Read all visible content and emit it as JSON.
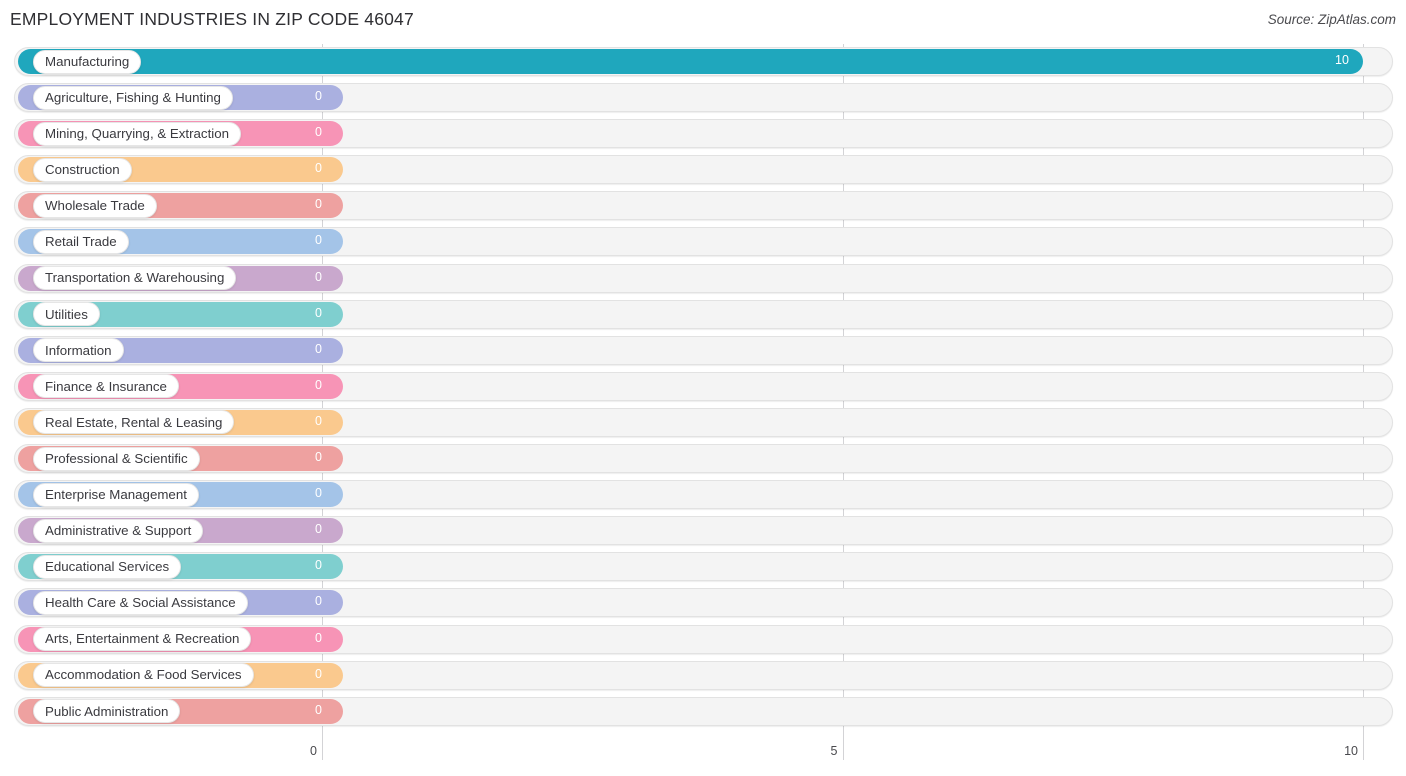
{
  "header": {
    "title": "EMPLOYMENT INDUSTRIES IN ZIP CODE 46047",
    "source": "Source: ZipAtlas.com"
  },
  "axis": {
    "ticks": [
      {
        "label": "0",
        "value": 0
      },
      {
        "label": "5",
        "value": 5
      },
      {
        "label": "10",
        "value": 10
      }
    ]
  },
  "chart_data": {
    "type": "bar",
    "orientation": "horizontal",
    "title": "EMPLOYMENT INDUSTRIES IN ZIP CODE 46047",
    "xlabel": "",
    "ylabel": "",
    "xlim": [
      0,
      10
    ],
    "grid": true,
    "legend": "none",
    "categories": [
      "Manufacturing",
      "Agriculture, Fishing & Hunting",
      "Mining, Quarrying, & Extraction",
      "Construction",
      "Wholesale Trade",
      "Retail Trade",
      "Transportation & Warehousing",
      "Utilities",
      "Information",
      "Finance & Insurance",
      "Real Estate, Rental & Leasing",
      "Professional & Scientific",
      "Enterprise Management",
      "Administrative & Support",
      "Educational Services",
      "Health Care & Social Assistance",
      "Arts, Entertainment & Recreation",
      "Accommodation & Food Services",
      "Public Administration"
    ],
    "values": [
      10,
      0,
      0,
      0,
      0,
      0,
      0,
      0,
      0,
      0,
      0,
      0,
      0,
      0,
      0,
      0,
      0,
      0,
      0
    ],
    "value_labels": [
      "10",
      "0",
      "0",
      "0",
      "0",
      "0",
      "0",
      "0",
      "0",
      "0",
      "0",
      "0",
      "0",
      "0",
      "0",
      "0",
      "0",
      "0",
      "0"
    ],
    "colors": [
      "#1fa7bd",
      "#aab0e0",
      "#f794b6",
      "#fac98e",
      "#eea1a0",
      "#a4c4e8",
      "#c9a8cd",
      "#7fcfcf",
      "#aab0e0",
      "#f794b6",
      "#fac98e",
      "#eea1a0",
      "#a4c4e8",
      "#c9a8cd",
      "#7fcfcf",
      "#aab0e0",
      "#f794b6",
      "#fac98e",
      "#eea1a0"
    ]
  }
}
